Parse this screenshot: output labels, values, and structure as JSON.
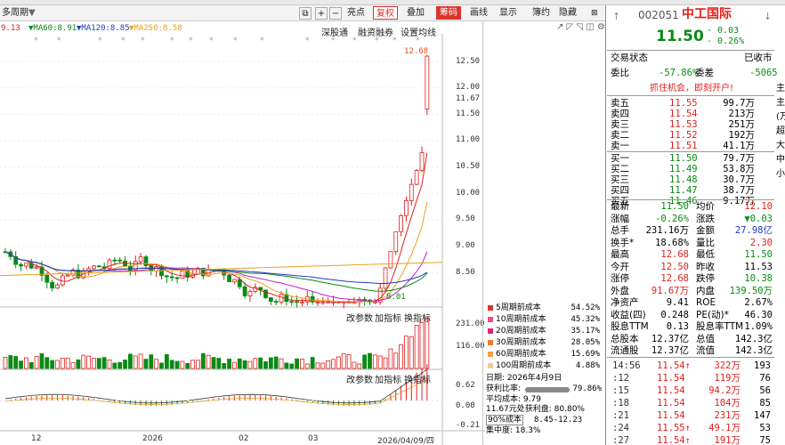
{
  "toolbar": {
    "period_label": "多周期",
    "items": [
      "亮点",
      "复权",
      "叠加",
      "筹码",
      "画线",
      "显示",
      "簿约",
      "隐藏"
    ],
    "selected_solid": "筹码",
    "selected_outline": "复权"
  },
  "ma": [
    {
      "label": "9.13",
      "color": "#e0201c"
    },
    {
      "label": "MA60:8.91",
      "color": "#0a8a14"
    },
    {
      "label": "MA120:8.85",
      "color": "#1e3cc8"
    },
    {
      "label": "MA250:8.58",
      "color": "#e8a020"
    }
  ],
  "chart_toolbar": {
    "items": [
      "深股通",
      "融资融券",
      "设置均线"
    ]
  },
  "price_axis": {
    "ticks": [
      "12.50",
      "12.00",
      "11.67",
      "11.50",
      "11.00",
      "10.50",
      "10.00",
      "9.50",
      "9.00",
      "8.50"
    ],
    "high_label": "12.68",
    "low_label": "8.01"
  },
  "volume_panel": {
    "labels": [
      "改参数",
      "加指标",
      "换指标"
    ],
    "ticks": [
      "231.00",
      "116.00"
    ]
  },
  "indicator_panel": {
    "labels": [
      "改参数",
      "加指标",
      "换指标"
    ],
    "ticks": [
      "0.62",
      "0.00",
      "-0.21"
    ]
  },
  "time_axis": {
    "labels": [
      "12",
      "2026",
      "02",
      "03",
      "2026/04/09/四"
    ]
  },
  "chip_legend": [
    {
      "label": "5周期前成本",
      "value": "54.52%",
      "color": "#d9342b"
    },
    {
      "label": "10周期前成本",
      "value": "45.32%",
      "color": "#e84c8c"
    },
    {
      "label": "20周期前成本",
      "value": "35.17%",
      "color": "#e02080"
    },
    {
      "label": "30周期前成本",
      "value": "28.05%",
      "color": "#f07830"
    },
    {
      "label": "60周期前成本",
      "value": "15.69%",
      "color": "#f0a040"
    },
    {
      "label": "100周期前成本",
      "value": "4.88%",
      "color": "#f6c890"
    }
  ],
  "chip_info": {
    "date": "日期: 2026年4月9日",
    "profit_ratio_label": "获利比率:",
    "profit_ratio": "79.86%",
    "avg_cost": "平均成本: 9.79",
    "profit_at": "11.67元处获利盘: 80.80%",
    "cost_range_label": "90%成本",
    "cost_range": "8.45-12.23",
    "concentration": "集中度: 18.3%"
  },
  "stock": {
    "code": "002051",
    "name": "中工国际",
    "price": "11.50",
    "change": "- 0.03",
    "change_pct": "- 0.26%",
    "status_label": "交易状态",
    "status": "已收市",
    "weibi_label": "委比",
    "weibi": "-57.86%",
    "weicha_label": "委差",
    "weicha": "-5065",
    "promo": "抓住机会，即刻开户!"
  },
  "sell_orders": [
    {
      "label": "卖五",
      "price": "11.55",
      "vol": "99.7万"
    },
    {
      "label": "卖四",
      "price": "11.54",
      "vol": "213万"
    },
    {
      "label": "卖三",
      "price": "11.53",
      "vol": "251万"
    },
    {
      "label": "卖二",
      "price": "11.52",
      "vol": "192万"
    },
    {
      "label": "卖一",
      "price": "11.51",
      "vol": "41.1万"
    }
  ],
  "buy_orders": [
    {
      "label": "买一",
      "price": "11.50",
      "vol": "79.7万"
    },
    {
      "label": "买二",
      "price": "11.49",
      "vol": "53.8万"
    },
    {
      "label": "买三",
      "price": "11.48",
      "vol": "30.7万"
    },
    {
      "label": "买四",
      "price": "11.47",
      "vol": "38.7万"
    },
    {
      "label": "买五",
      "price": "11.46",
      "vol": "9.17万"
    }
  ],
  "stats": [
    {
      "l1": "最新",
      "v1": "11.50",
      "c1": "green",
      "l2": "均价",
      "v2": "12.10",
      "c2": "red"
    },
    {
      "l1": "涨幅",
      "v1": "-0.26%",
      "c1": "green",
      "l2": "涨跌",
      "v2": "▼0.03",
      "c2": "green"
    },
    {
      "l1": "总手",
      "v1": "231.16万",
      "c1": "black",
      "l2": "金额",
      "v2": "27.98亿",
      "c2": "blue"
    },
    {
      "l1": "换手*",
      "v1": "18.68%",
      "c1": "black",
      "l2": "量比",
      "v2": "2.30",
      "c2": "red"
    },
    {
      "l1": "最高",
      "v1": "12.68",
      "c1": "red",
      "l2": "最低",
      "v2": "11.50",
      "c2": "green"
    },
    {
      "l1": "今开",
      "v1": "12.50",
      "c1": "red",
      "l2": "昨收",
      "v2": "11.53",
      "c2": "black"
    },
    {
      "l1": "涨停",
      "v1": "12.68",
      "c1": "red",
      "l2": "跌停",
      "v2": "10.38",
      "c2": "green"
    },
    {
      "l1": "外盘",
      "v1": "91.67万",
      "c1": "red",
      "l2": "内盘",
      "v2": "139.50万",
      "c2": "green"
    },
    {
      "l1": "净资产",
      "v1": "9.41",
      "c1": "black",
      "l2": "ROE",
      "v2": "2.67%",
      "c2": "black"
    },
    {
      "l1": "收益(四)",
      "v1": "0.248",
      "c1": "black",
      "l2": "PE(动)*",
      "v2": "46.30",
      "c2": "black"
    },
    {
      "l1": "股息TTM",
      "v1": "0.13",
      "c1": "black",
      "l2": "股息率TTM",
      "v2": "1.09%",
      "c2": "black"
    },
    {
      "l1": "总股本",
      "v1": "12.37亿",
      "c1": "black",
      "l2": "总值",
      "v2": "142.3亿",
      "c2": "black"
    },
    {
      "l1": "流通股",
      "v1": "12.37亿",
      "c1": "black",
      "l2": "流值",
      "v2": "142.3亿",
      "c2": "black"
    }
  ],
  "ticks": [
    {
      "time": "14:56",
      "price": "11.54",
      "arrow": "↑",
      "vol": "322万",
      "num": "193"
    },
    {
      "time": ":12",
      "price": "11.54",
      "arrow": "",
      "vol": "119万",
      "num": "76"
    },
    {
      "time": ":15",
      "price": "11.54",
      "arrow": "",
      "vol": "94.2万",
      "num": "56"
    },
    {
      "time": ":18",
      "price": "11.54",
      "arrow": "",
      "vol": "104万",
      "num": "85"
    },
    {
      "time": ":21",
      "price": "11.54",
      "arrow": "",
      "vol": "231万",
      "num": "147"
    },
    {
      "time": ":24",
      "price": "11.55",
      "arrow": "↑",
      "vol": "49.1万",
      "num": "53"
    },
    {
      "time": ":27",
      "price": "11.54",
      "arrow": "↑",
      "vol": "191万",
      "num": "75"
    }
  ],
  "edge_labels": [
    "主",
    "主",
    "(万",
    "超",
    "大",
    "中",
    "小"
  ]
}
